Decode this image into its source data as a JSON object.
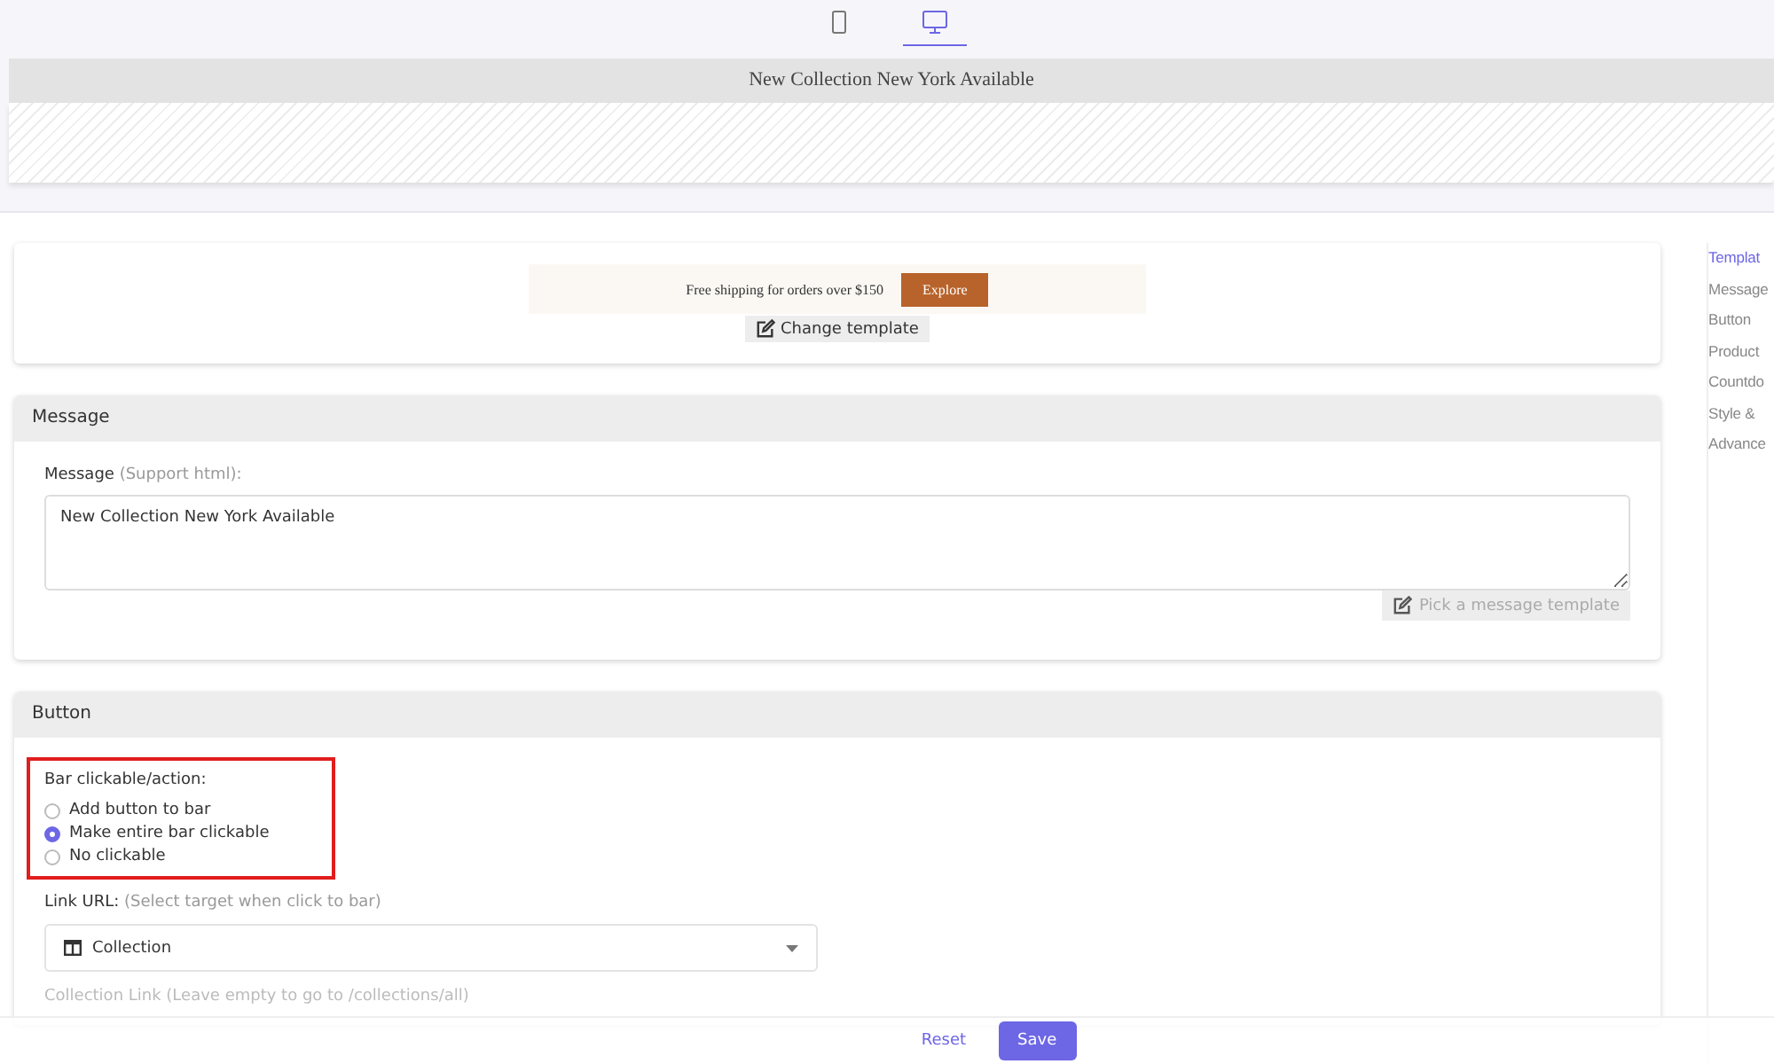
{
  "device_toggle": [
    {
      "kind": "mobile",
      "selected": false
    },
    {
      "kind": "desktop",
      "selected": true
    }
  ],
  "preview": {
    "announcement": "New Collection New York Available"
  },
  "template_card": {
    "sample_text": "Free shipping for orders over $150",
    "sample_button": "Explore",
    "change_button": "Change template"
  },
  "message_card": {
    "title": "Message",
    "field_label": "Message",
    "field_hint": "(Support html):",
    "value": "New Collection New York Available",
    "pick_button": "Pick a message template",
    "pick_disabled": true
  },
  "button_card": {
    "title": "Button",
    "action_label": "Bar clickable/action:",
    "highlighted": true,
    "options": [
      {
        "label": "Add button to bar",
        "selected": false
      },
      {
        "label": "Make entire bar clickable",
        "selected": true
      },
      {
        "label": "No clickable",
        "selected": false
      }
    ],
    "link_label": "Link URL:",
    "link_hint": "(Select target when click to bar)",
    "link_value": "Collection",
    "collection_label": "Collection Link",
    "collection_hint": "(Leave empty to go to /collections/all)"
  },
  "section_nav": [
    {
      "label": "Templat",
      "selected": true
    },
    {
      "label": "Message",
      "selected": false
    },
    {
      "label": "Button",
      "selected": false
    },
    {
      "label": "Product",
      "selected": false
    },
    {
      "label": "Countdo",
      "selected": false
    },
    {
      "label": "Style &",
      "selected": false
    },
    {
      "label": "Advance",
      "selected": false
    }
  ],
  "footer": {
    "reset": "Reset",
    "save": "Save"
  }
}
